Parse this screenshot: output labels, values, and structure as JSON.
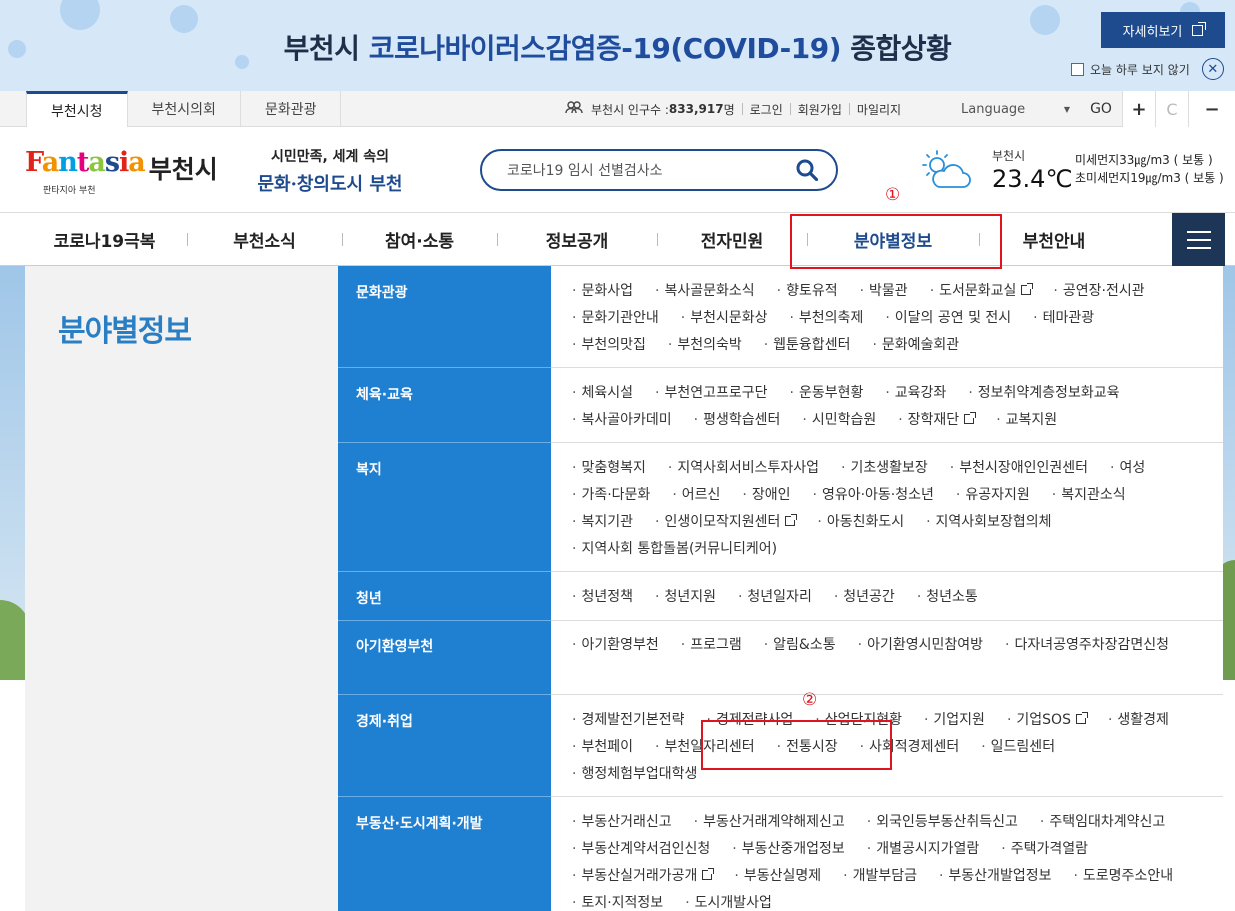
{
  "banner": {
    "title_prefix": "부천시 ",
    "title_accent": "코로나바이러스감염증-19(COVID-19)",
    "title_suffix": " 종합상황",
    "detail_button": "자세히보기",
    "today_label": "오늘 하루 보지 않기",
    "close_symbol": "✕"
  },
  "util": {
    "site_tabs": [
      "부천시청",
      "부천시의회",
      "문화관광"
    ],
    "population_label": "부천시 인구수 : ",
    "population_value": "833,917",
    "population_unit": " 명",
    "login": "로그인",
    "signup": "회원가입",
    "mileage": "마일리지",
    "language": "Language",
    "go": "GO",
    "zoom_in": "+",
    "reset": "C",
    "zoom_out": "−"
  },
  "header": {
    "logo_letters": [
      "F",
      "a",
      "n",
      "t",
      "a",
      "s",
      "i",
      "a"
    ],
    "logo_city": "부천시",
    "logo_sub": "판타지아 부천",
    "slogan_line1": "시민만족, 세계 속의",
    "slogan_line2": "문화·창의도시 부천",
    "search_placeholder": "코로나19 임시 선별검사소",
    "weather_city": "부천시",
    "weather_temp": "23.4℃",
    "dust_pm10": "미세먼지33㎍/m3 ( 보통 )",
    "dust_pm25": "초미세먼지19㎍/m3 ( 보통 )"
  },
  "gnb": {
    "items": [
      "코로나19극복",
      "부천소식",
      "참여·소통",
      "정보공개",
      "전자민원",
      "분야별정보",
      "부천안내"
    ],
    "active_index": 5
  },
  "panel": {
    "title": "분야별정보",
    "categories": [
      {
        "name": "문화관광",
        "links": [
          "문화사업",
          "복사골문화소식",
          "향토유적",
          "박물관",
          "도서문화교실",
          "공연장·전시관",
          "문화기관안내",
          "부천시문화상",
          "부천의축제",
          "이달의 공연 및 전시",
          "테마관광",
          "부천의맛집",
          "부천의숙박",
          "웹툰융합센터",
          "문화예술회관"
        ]
      },
      {
        "name": "체육·교육",
        "links": [
          "체육시설",
          "부천연고프로구단",
          "운동부현황",
          "교육강좌",
          "정보취약계층정보화교육",
          "복사골아카데미",
          "평생학습센터",
          "시민학습원",
          "장학재단",
          "교복지원"
        ]
      },
      {
        "name": "복지",
        "links": [
          "맞춤형복지",
          "지역사회서비스투자사업",
          "기초생활보장",
          "부천시장애인인권센터",
          "여성",
          "가족·다문화",
          "어르신",
          "장애인",
          "영유아·아동·청소년",
          "유공자지원",
          "복지관소식",
          "복지기관",
          "인생이모작지원센터",
          "아동친화도시",
          "지역사회보장협의체",
          "지역사회 통합돌봄(커뮤니티케어)"
        ]
      },
      {
        "name": "청년",
        "links": [
          "청년정책",
          "청년지원",
          "청년일자리",
          "청년공간",
          "청년소통"
        ]
      },
      {
        "name": "아기환영부천",
        "links": [
          "아기환영부천",
          "프로그램",
          "알림&소통",
          "아기환영시민참여방",
          "다자녀공영주차장감면신청"
        ]
      },
      {
        "name": "경제·취업",
        "links": [
          "경제발전기본전략",
          "경제전략사업",
          "산업단지현황",
          "기업지원",
          "기업SOS",
          "생활경제",
          "부천페이",
          "부천일자리센터",
          "전통시장",
          "사회적경제센터",
          "일드림센터",
          "행정체험부업대학생"
        ]
      },
      {
        "name": "부동산·도시계획·개발",
        "links": [
          "부동산거래신고",
          "부동산거래계약해제신고",
          "외국인등부동산취득신고",
          "주택임대차계약신고",
          "부동산계약서검인신청",
          "부동산중개업정보",
          "개별공시지가열람",
          "주택가격열람",
          "부동산실거래가공개",
          "부동산실명제",
          "개발부담금",
          "부동산개발업정보",
          "도로명주소안내",
          "토지·지적정보",
          "도시개발사업"
        ]
      }
    ]
  },
  "annotations": {
    "first": "①",
    "second": "②"
  },
  "colors": {
    "brand": "#1e4b8e",
    "category_bg": "#1f7fd1",
    "annotation": "#e0141e",
    "title": "#2a7fc4"
  }
}
